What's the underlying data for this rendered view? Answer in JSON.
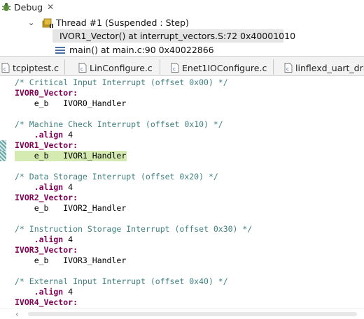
{
  "debug": {
    "title": "Debug",
    "close_glyph": "✕",
    "thread_chevron": "⌄",
    "thread": "Thread #1 (Suspended : Step)",
    "frames": [
      "IVOR1_Vector() at interrupt_vectors.S:72 0x40001010",
      "main() at main.c:90 0x40022866"
    ]
  },
  "tabs": [
    "tcpiptest.c",
    "LinConfigure.c",
    "Enet1IOConfigure.c",
    "linflexd_uart_driv"
  ],
  "code": {
    "lines": [
      {
        "cls": "comment",
        "text": "/* Critical Input Interrupt (offset 0x00) */"
      },
      {
        "cls": "label",
        "text": "IVOR0_Vector:"
      },
      {
        "cls": "plain",
        "text": "    e_b   IVOR0_Handler"
      },
      {
        "cls": "plain",
        "text": ""
      },
      {
        "cls": "comment",
        "text": "/* Machine Check Interrupt (offset 0x10) */"
      },
      {
        "cls": "directive",
        "text": "    .align",
        "tail": " 4"
      },
      {
        "cls": "label",
        "text": "IVOR1_Vector:"
      },
      {
        "cls": "plain",
        "text": "    e_b   IVOR1_Handler",
        "current": true
      },
      {
        "cls": "plain",
        "text": ""
      },
      {
        "cls": "comment",
        "text": "/* Data Storage Interrupt (offset 0x20) */"
      },
      {
        "cls": "directive",
        "text": "    .align",
        "tail": " 4"
      },
      {
        "cls": "label",
        "text": "IVOR2_Vector:"
      },
      {
        "cls": "plain",
        "text": "    e_b   IVOR2_Handler"
      },
      {
        "cls": "plain",
        "text": ""
      },
      {
        "cls": "comment",
        "text": "/* Instruction Storage Interrupt (offset 0x30) */"
      },
      {
        "cls": "directive",
        "text": "    .align",
        "tail": " 4"
      },
      {
        "cls": "label",
        "text": "IVOR3_Vector:"
      },
      {
        "cls": "plain",
        "text": "    e_b   IVOR3_Handler"
      },
      {
        "cls": "plain",
        "text": ""
      },
      {
        "cls": "comment",
        "text": "/* External Input Interrupt (offset 0x40) */"
      },
      {
        "cls": "directive",
        "text": "    .align",
        "tail": " 4"
      },
      {
        "cls": "label",
        "text": "IVOR4_Vector:"
      }
    ]
  },
  "scrollbar": {
    "left_arrow": "‹"
  },
  "colors": {
    "comment": "#3f7f7f",
    "keyword": "#7f0055",
    "current_line": "#d4eab0",
    "selected_frame": "#e5e5e5"
  }
}
